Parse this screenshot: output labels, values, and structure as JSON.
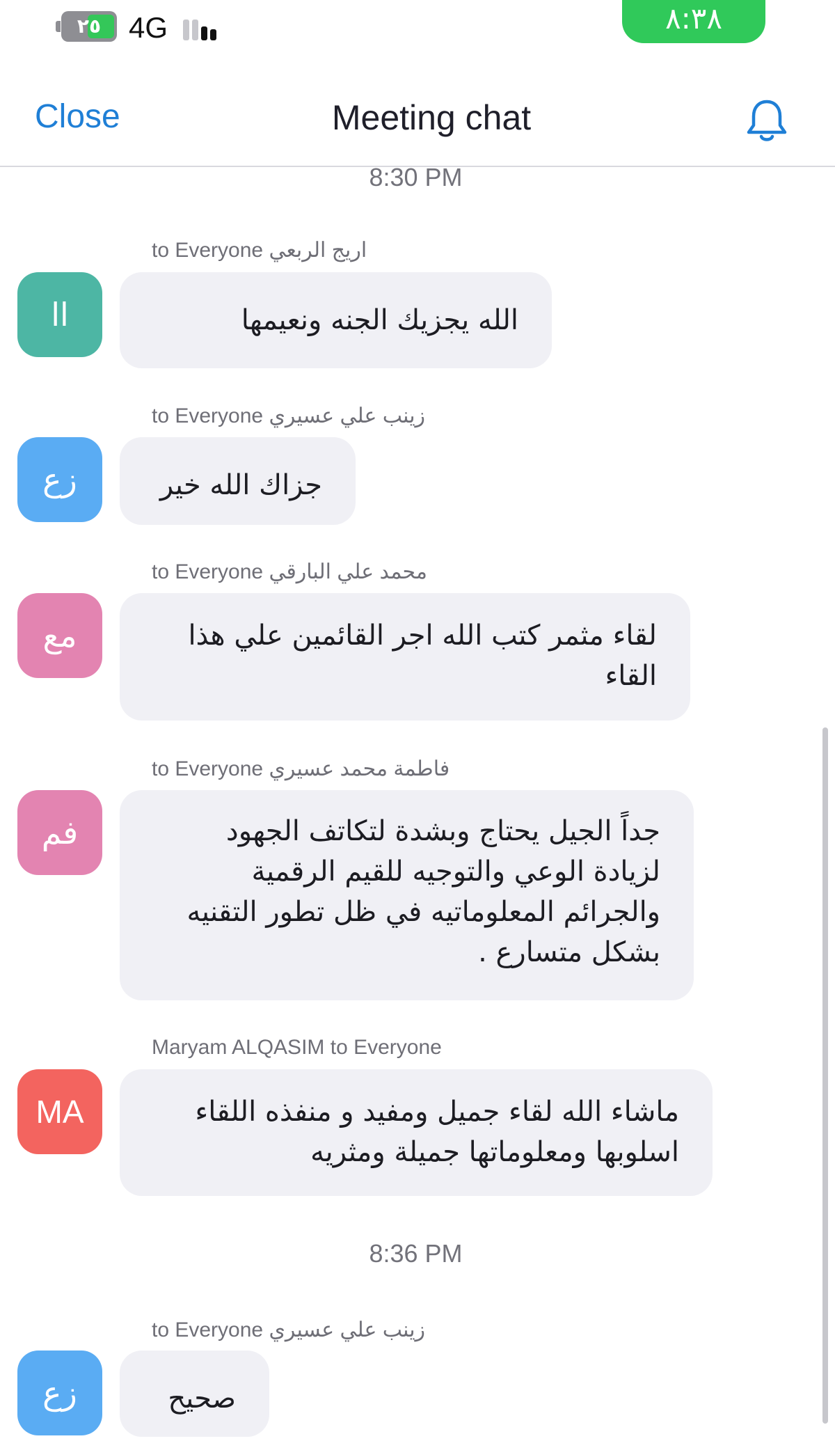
{
  "status_bar": {
    "battery": "٢٥",
    "network": "4G",
    "time": "٨:٣٨"
  },
  "header": {
    "close_label": "Close",
    "title": "Meeting chat",
    "bell_icon": "bell-icon"
  },
  "timestamps": [
    "8:30 PM",
    "8:36 PM"
  ],
  "messages": [
    {
      "sender": "اريج الربعي",
      "to": "to Everyone",
      "avatar_initials": "اا",
      "avatar_color": "#4db6a4",
      "lines": [
        "الله يجزيك الجنه ونعيمها"
      ]
    },
    {
      "sender": "زينب علي عسيري",
      "to": "to Everyone",
      "avatar_initials": "زع",
      "avatar_color": "#5aacf3",
      "lines": [
        "جزاك الله خير"
      ]
    },
    {
      "sender": "محمد علي البارقي",
      "to": "to Everyone",
      "avatar_initials": "مع",
      "avatar_color": "#e384b1",
      "lines": [
        "لقاء مثمر كتب الله اجر القائمين علي هذا",
        "القاء"
      ]
    },
    {
      "sender": "فاطمة محمد عسيري",
      "to": "to Everyone",
      "avatar_initials": "فم",
      "avatar_color": "#e384b1",
      "lines": [
        "جداً الجيل يحتاج وبشدة لتكاتف الجهود",
        "لزيادة الوعي والتوجيه للقيم الرقمية",
        "والجرائم المعلوماتيه في ظل تطور التقنيه",
        "بشكل متسارع ."
      ]
    },
    {
      "sender": "Maryam ALQASIM",
      "to": "to Everyone",
      "avatar_initials": "MA",
      "avatar_color": "#f3645f",
      "lines": [
        "ماشاء الله لقاء جميل ومفيد و منفذه اللقاء",
        "اسلوبها ومعلوماتها جميلة ومثريه"
      ]
    },
    {
      "sender": "زينب علي عسيري",
      "to": "to Everyone",
      "avatar_initials": "زع",
      "avatar_color": "#5aacf3",
      "lines": [
        "صحيح"
      ]
    }
  ]
}
